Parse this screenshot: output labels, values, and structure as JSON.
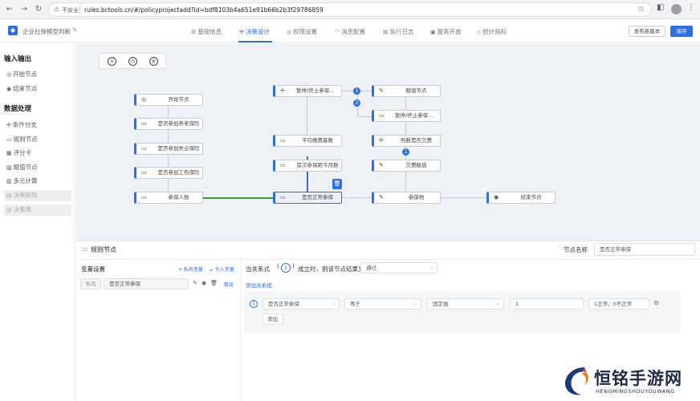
{
  "browser": {
    "secure_label": "不安全",
    "url": "rules.bctools.cn/#/policyprojectadd?id=bdf8103b4a651e91b66b2b3f29786859"
  },
  "header": {
    "app_title": "企业社保模型判断",
    "tabs": [
      {
        "label": "基础信息",
        "icon": "gear-icon"
      },
      {
        "label": "决策设计",
        "icon": "decision-icon"
      },
      {
        "label": "权限设置",
        "icon": "lock-icon"
      },
      {
        "label": "消息配置",
        "icon": "headset-icon"
      },
      {
        "label": "执行日志",
        "icon": "log-icon"
      },
      {
        "label": "服务开放",
        "icon": "service-icon"
      },
      {
        "label": "统计指标",
        "icon": "shield-icon"
      }
    ],
    "active_tab": "决策设计",
    "publish_label": "发布新版本",
    "save_label": "保存"
  },
  "palette": {
    "io_title": "输入输出",
    "io_items": [
      {
        "label": "开始节点",
        "icon": "start-icon"
      },
      {
        "label": "结束节点",
        "icon": "end-icon"
      }
    ],
    "proc_title": "数据处理",
    "proc_items": [
      {
        "label": "条件分支",
        "icon": "branch-icon",
        "disabled": false
      },
      {
        "label": "规则节点",
        "icon": "rule-icon",
        "disabled": false
      },
      {
        "label": "评分卡",
        "icon": "scorecard-icon",
        "disabled": false
      },
      {
        "label": "赋值节点",
        "icon": "assign-icon",
        "disabled": false
      },
      {
        "label": "多元计算",
        "icon": "calc-icon",
        "disabled": false
      },
      {
        "label": "决策矩阵",
        "icon": "matrix-icon",
        "disabled": true
      },
      {
        "label": "决策表",
        "icon": "table-icon",
        "disabled": true
      }
    ]
  },
  "canvas": {
    "toolbar": [
      "①",
      "◷",
      "⑧"
    ],
    "nodes": {
      "start": "开始节点",
      "n1": "是否参加养老保险",
      "n2": "是否参加失业保险",
      "n3": "是否参加工伤保险",
      "n4": "参保人数",
      "center": "是否正常参保",
      "first_pay": "首次参保距今月数",
      "avg_pay": "平均缴费基数",
      "stop": "暂停/终止参保时...",
      "assign": "赋值节点",
      "stop2": "暂停/终止参保时...",
      "judge": "判断是否欠费",
      "fee_assign": "欠费赋值",
      "insured": "参保地",
      "end": "结束节点"
    },
    "badges": [
      "1",
      "2",
      "1"
    ]
  },
  "detail": {
    "title": "规则节点",
    "node_name_label": "节点名称",
    "node_name_value": "是否正常参保",
    "var_settings": "变量设置",
    "add_private": "+ 私有变量",
    "import_var": "↙ 引入变量",
    "var_kind": "私有",
    "var_name": "是否正常参保",
    "var_type": "数组",
    "cond_prefix": "当关系式",
    "cond_num": "1",
    "cond_suffix": "成立时，则该节点结果为",
    "cond_result": "通过",
    "add_relation": "添加关系组",
    "row_index": "1",
    "row_var": "是否正常参保",
    "row_op": "等于",
    "row_type": "固定值",
    "row_value": "1",
    "row_note": "1正常，0不正常",
    "add_btn": "添加"
  },
  "watermark": {
    "cn": "恒铭手游网",
    "en": "HENGMINGSHOUYOUWANG"
  }
}
